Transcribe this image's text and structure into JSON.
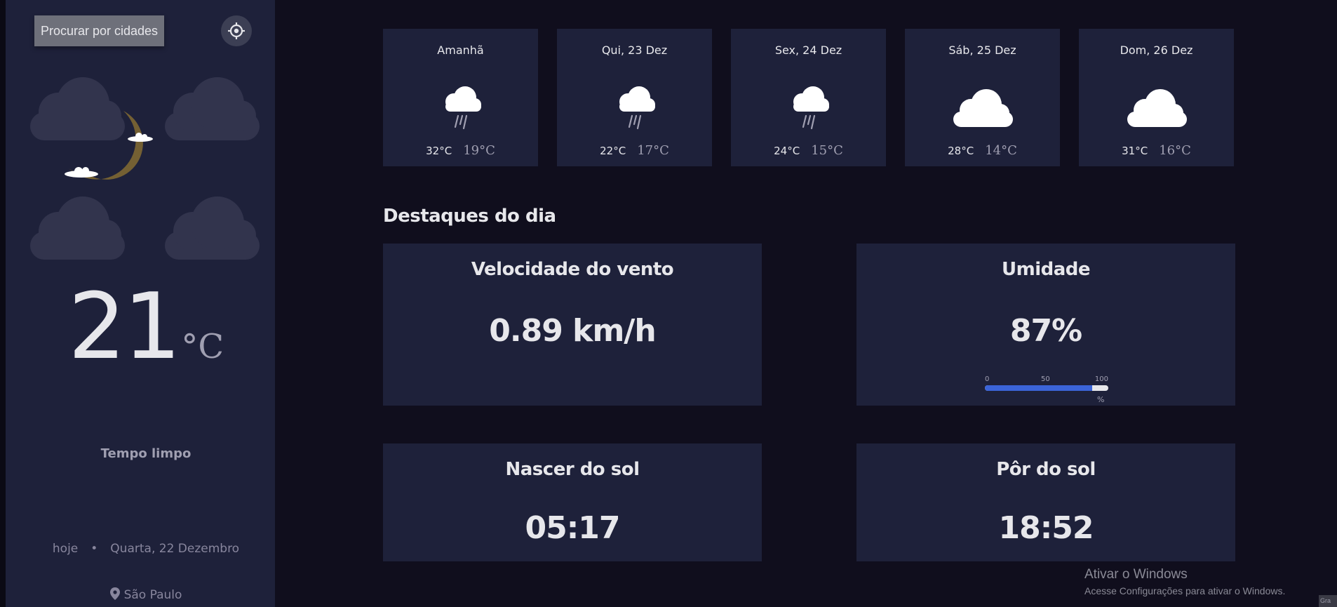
{
  "sidebar": {
    "search_label": "Procurar por cidades",
    "current": {
      "temperature": "21",
      "unit": "°C",
      "condition": "Tempo limpo",
      "day_label": "hoje",
      "separator": "•",
      "date": "Quarta, 22 Dezembro",
      "location": "São Paulo",
      "icon": "moon-clouds-icon"
    }
  },
  "forecast": [
    {
      "day": "Amanhã",
      "max": "32°C",
      "min": "19°C",
      "icon": "rain-cloud-icon"
    },
    {
      "day": "Qui, 23 Dez",
      "max": "22°C",
      "min": "17°C",
      "icon": "rain-cloud-icon"
    },
    {
      "day": "Sex, 24 Dez",
      "max": "24°C",
      "min": "15°C",
      "icon": "rain-cloud-icon"
    },
    {
      "day": "Sáb, 25 Dez",
      "max": "28°C",
      "min": "14°C",
      "icon": "cloud-icon"
    },
    {
      "day": "Dom, 26 Dez",
      "max": "31°C",
      "min": "16°C",
      "icon": "cloud-icon"
    }
  ],
  "highlights": {
    "title": "Destaques do dia",
    "wind": {
      "label": "Velocidade do vento",
      "value": "0.89 km/h"
    },
    "humidity": {
      "label": "Umidade",
      "value": "87%",
      "percent": 87,
      "scale": [
        "0",
        "50",
        "100"
      ],
      "unit": "%"
    },
    "sunrise": {
      "label": "Nascer do sol",
      "value": "05:17"
    },
    "sunset": {
      "label": "Pôr do sol",
      "value": "18:52"
    }
  },
  "colors": {
    "background": "#100e1d",
    "panel": "#1e213a",
    "accent": "#3b64d8",
    "text": "#e7e7eb",
    "muted": "#a09fb1"
  },
  "windows": {
    "activation_title": "Ativar o Windows",
    "activation_sub": "Acesse Configurações para ativar o Windows.",
    "corner_text": "Gra"
  }
}
